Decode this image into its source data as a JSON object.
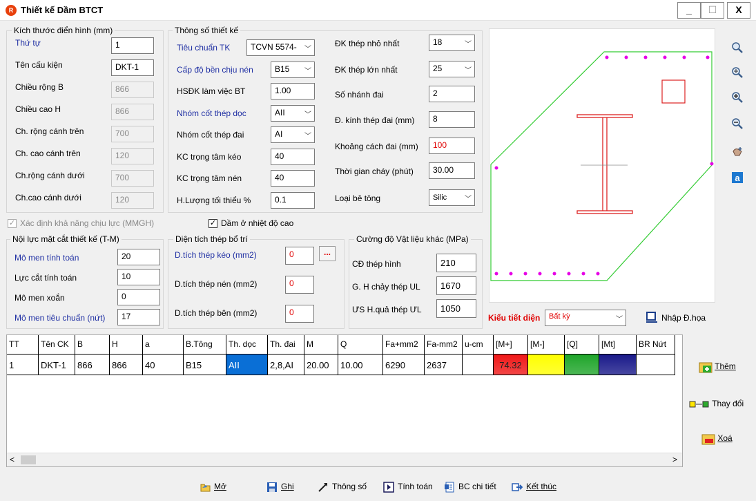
{
  "window": {
    "icon_text": "R",
    "title": "Thiết kế Dầm BTCT",
    "minimize": "_",
    "maximize": "☐",
    "close": "X"
  },
  "dims": {
    "title": "Kích thước điển hình (mm)",
    "rows": [
      {
        "label": "Thứ tự",
        "value": "1",
        "label_blue": true,
        "enabled": true
      },
      {
        "label": "Tên cấu kiện",
        "value": "DKT-1",
        "label_blue": false,
        "enabled": true
      },
      {
        "label": "Chiều rộng B",
        "value": "866",
        "label_blue": false,
        "enabled": false
      },
      {
        "label": "Chiều cao H",
        "value": "866",
        "label_blue": false,
        "enabled": false
      },
      {
        "label": "Ch. rộng cánh trên",
        "value": "700",
        "label_blue": false,
        "enabled": false
      },
      {
        "label": "Ch. cao cánh trên",
        "value": "120",
        "label_blue": false,
        "enabled": false
      },
      {
        "label": "Ch.rộng cánh dưới",
        "value": "700",
        "label_blue": false,
        "enabled": false
      },
      {
        "label": "Ch.cao cánh dưới",
        "value": "120",
        "label_blue": false,
        "enabled": false
      }
    ]
  },
  "params": {
    "title": "Thông số thiết kế",
    "left": [
      {
        "label": "Tiêu chuẩn TK",
        "value": "TCVN 5574-",
        "type": "select",
        "label_blue": true
      },
      {
        "label": "Cấp độ bền chịu nén",
        "value": "B15",
        "type": "select",
        "label_blue": true
      },
      {
        "label": "HSĐK làm việc BT",
        "value": "1.00",
        "type": "text",
        "label_blue": false
      },
      {
        "label": "Nhóm cốt thép dọc",
        "value": "AII",
        "type": "select",
        "label_blue": true
      },
      {
        "label": "Nhóm cốt thép đai",
        "value": "AI",
        "type": "select",
        "label_blue": false
      },
      {
        "label": "KC trọng tâm kéo",
        "value": "40",
        "type": "text",
        "label_blue": false
      },
      {
        "label": "KC trọng tâm nén",
        "value": "40",
        "type": "text",
        "label_blue": false
      },
      {
        "label": "H.Lượng tối thiểu %",
        "value": "0.1",
        "type": "text",
        "label_blue": false
      }
    ],
    "right": [
      {
        "label": "ĐK thép nhỏ nhất",
        "value": "18",
        "type": "select",
        "value_red": false
      },
      {
        "label": "ĐK thép lớn nhất",
        "value": "25",
        "type": "select",
        "value_red": false
      },
      {
        "label": "Số nhánh đai",
        "value": "2",
        "type": "text",
        "value_red": false
      },
      {
        "label": "Đ. kính thép đai (mm)",
        "value": "8",
        "type": "text",
        "value_red": false
      },
      {
        "label": "Khoảng cách đai (mm)",
        "value": "100",
        "type": "text",
        "value_red": true
      },
      {
        "label": "Thời gian cháy (phút)",
        "value": "30.00",
        "type": "text",
        "value_red": false
      },
      {
        "label": "Loại bê tông",
        "value": "Silic",
        "type": "select",
        "value_red": false
      }
    ]
  },
  "checks": {
    "mmgh": "Xác định khả năng chịu lực (MMGH)",
    "high_temp": "Dầm ở  nhiệt độ cao"
  },
  "forces": {
    "title": "Nội lực mặt cắt thiết kế (T-M)",
    "rows": [
      {
        "label": "Mô men tính toán",
        "value": "20",
        "label_blue": true
      },
      {
        "label": "Lực cắt tính toán",
        "value": "10",
        "label_blue": false
      },
      {
        "label": "Mô men xoắn",
        "value": "0",
        "label_blue": false
      },
      {
        "label": "Mô men tiêu chuẩn (nứt)",
        "value": "17",
        "label_blue": true
      }
    ]
  },
  "steel_area": {
    "title": "Diện tích thép bổ trí",
    "rows": [
      {
        "label": "D.tích thép kéo (mm2)",
        "value": "0",
        "label_blue": true
      },
      {
        "label": "D.tích thép nén (mm2)",
        "value": "0",
        "label_blue": false
      },
      {
        "label": "D.tích thép bên (mm2)",
        "value": "0",
        "label_blue": false
      }
    ],
    "dots_button": "..."
  },
  "other_strength": {
    "title": "Cường độ Vật liệu khác (MPa)",
    "rows": [
      {
        "label": "CĐ thép hình",
        "value": "210"
      },
      {
        "label": "G. H chảy thép UL",
        "value": "1670"
      },
      {
        "label": "ƯS H.quả thép  ƯL",
        "value": "1050"
      }
    ]
  },
  "section": {
    "type_label": "Kiểu tiết diện",
    "type_value": "Bất kỳ",
    "import_label": "Nhập Đ.họa"
  },
  "grid": {
    "headers": [
      "TT",
      "Tên CK",
      "B",
      "H",
      "a",
      "B.Tông",
      "Th. dọc",
      "Th. đai",
      "M",
      "Q",
      "Fa+mm2",
      "Fa-mm2",
      "u-cm",
      "[M+]",
      "[M-]",
      "[Q]",
      "[Mt]",
      "BR Nứt"
    ],
    "rows": [
      [
        "1",
        "DKT-1",
        "866",
        "866",
        "40",
        "B15",
        "AII",
        "2,8,AI",
        "20.00",
        "10.00",
        "6290",
        "2637",
        "",
        "74.32",
        "",
        "",
        "",
        ""
      ]
    ],
    "scroll_left": "<",
    "scroll_right": ">"
  },
  "side_buttons": {
    "add": "Thêm",
    "change": "Thay đổi",
    "delete": "Xoá"
  },
  "bottom_buttons": {
    "open": "Mở",
    "save": "Ghi",
    "params": "Thông số",
    "calc": "Tính toán",
    "report": "BC chi tiết",
    "exit": "Kết thúc"
  },
  "colors": {
    "label_blue": "#1f2fa3",
    "red": "#e00000",
    "section_green": "#33cc33",
    "rebar_magenta": "#e600e6",
    "steel_red": "#dd2222",
    "m_plus": "#f01818",
    "m_minus": "#ffff00",
    "q": "#1fa52a",
    "mt": "#1a1a8a",
    "selected_cell": "#0a6fd6"
  }
}
